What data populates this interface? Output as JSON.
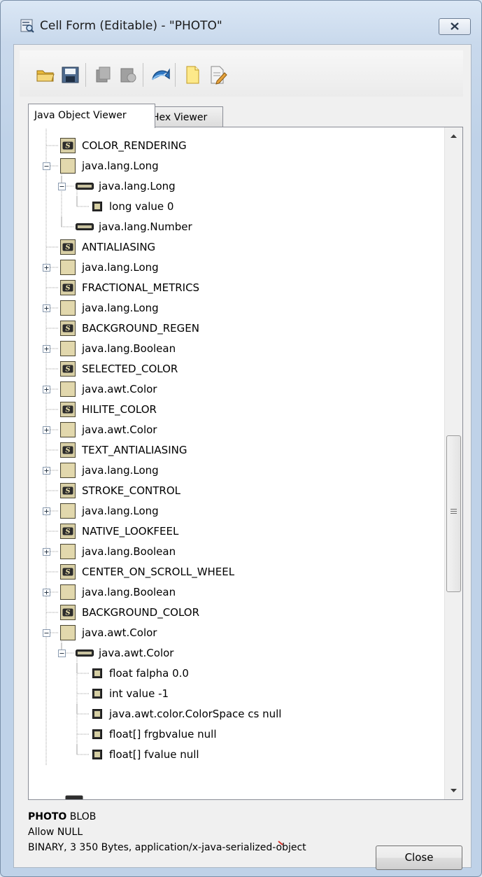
{
  "window": {
    "title": "Cell Form (Editable) - \"PHOTO\""
  },
  "toolbar": {
    "buttons": [
      "open-folder-icon",
      "save-icon",
      "copy-icon",
      "paste-icon",
      "refresh-icon",
      "new-file-icon",
      "edit-file-icon"
    ]
  },
  "tabs": [
    {
      "label": "Java Object Viewer",
      "active": true
    },
    {
      "label": "Hex Viewer",
      "active": false
    }
  ],
  "tree": [
    {
      "label": "COLOR_RENDERING",
      "icon": "s",
      "depth": 0,
      "toggle": "none"
    },
    {
      "label": "java.lang.Long",
      "icon": "obj",
      "depth": 0,
      "toggle": "minus"
    },
    {
      "label": "java.lang.Long",
      "icon": "class",
      "depth": 1,
      "toggle": "minus"
    },
    {
      "label": "long value 0",
      "icon": "field",
      "depth": 2,
      "toggle": "none"
    },
    {
      "label": "java.lang.Number",
      "icon": "class",
      "depth": 1,
      "toggle": "none"
    },
    {
      "label": "ANTIALIASING",
      "icon": "s",
      "depth": 0,
      "toggle": "none"
    },
    {
      "label": "java.lang.Long",
      "icon": "obj",
      "depth": 0,
      "toggle": "plus"
    },
    {
      "label": "FRACTIONAL_METRICS",
      "icon": "s",
      "depth": 0,
      "toggle": "none"
    },
    {
      "label": "java.lang.Long",
      "icon": "obj",
      "depth": 0,
      "toggle": "plus"
    },
    {
      "label": "BACKGROUND_REGEN",
      "icon": "s",
      "depth": 0,
      "toggle": "none"
    },
    {
      "label": "java.lang.Boolean",
      "icon": "obj",
      "depth": 0,
      "toggle": "plus"
    },
    {
      "label": "SELECTED_COLOR",
      "icon": "s",
      "depth": 0,
      "toggle": "none"
    },
    {
      "label": "java.awt.Color",
      "icon": "obj",
      "depth": 0,
      "toggle": "plus"
    },
    {
      "label": "HILITE_COLOR",
      "icon": "s",
      "depth": 0,
      "toggle": "none"
    },
    {
      "label": "java.awt.Color",
      "icon": "obj",
      "depth": 0,
      "toggle": "plus"
    },
    {
      "label": "TEXT_ANTIALIASING",
      "icon": "s",
      "depth": 0,
      "toggle": "none"
    },
    {
      "label": "java.lang.Long",
      "icon": "obj",
      "depth": 0,
      "toggle": "plus"
    },
    {
      "label": "STROKE_CONTROL",
      "icon": "s",
      "depth": 0,
      "toggle": "none"
    },
    {
      "label": "java.lang.Long",
      "icon": "obj",
      "depth": 0,
      "toggle": "plus"
    },
    {
      "label": "NATIVE_LOOKFEEL",
      "icon": "s",
      "depth": 0,
      "toggle": "none"
    },
    {
      "label": "java.lang.Boolean",
      "icon": "obj",
      "depth": 0,
      "toggle": "plus"
    },
    {
      "label": "CENTER_ON_SCROLL_WHEEL",
      "icon": "s",
      "depth": 0,
      "toggle": "none"
    },
    {
      "label": "java.lang.Boolean",
      "icon": "obj",
      "depth": 0,
      "toggle": "plus"
    },
    {
      "label": "BACKGROUND_COLOR",
      "icon": "s",
      "depth": 0,
      "toggle": "none"
    },
    {
      "label": "java.awt.Color",
      "icon": "obj",
      "depth": 0,
      "toggle": "minus"
    },
    {
      "label": "java.awt.Color",
      "icon": "class",
      "depth": 1,
      "toggle": "minus"
    },
    {
      "label": "float falpha 0.0",
      "icon": "field",
      "depth": 2,
      "toggle": "none"
    },
    {
      "label": "int value -1",
      "icon": "field",
      "depth": 2,
      "toggle": "none"
    },
    {
      "label": "java.awt.color.ColorSpace cs null",
      "icon": "field",
      "depth": 2,
      "toggle": "none"
    },
    {
      "label": "float[] frgbvalue null",
      "icon": "field",
      "depth": 2,
      "toggle": "none"
    },
    {
      "label": "float[] fvalue null",
      "icon": "field",
      "depth": 2,
      "toggle": "none"
    }
  ],
  "info": {
    "column_name": "PHOTO",
    "column_type": "BLOB",
    "nullable": "Allow NULL",
    "details": "BINARY, 3 350 Bytes, application/x-java-serialized-object"
  },
  "buttons": {
    "close": "Close"
  }
}
